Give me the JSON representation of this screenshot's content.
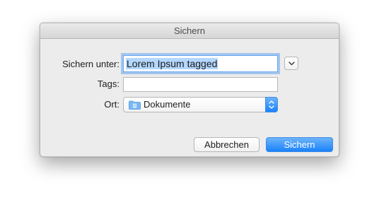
{
  "dialog": {
    "title": "Sichern"
  },
  "form": {
    "save_as_label": "Sichern unter:",
    "save_as_value": "Lorem Ipsum tagged",
    "tags_label": "Tags:",
    "tags_value": "",
    "location_label": "Ort:",
    "location_value": "Dokumente"
  },
  "buttons": {
    "cancel_label": "Abbrechen",
    "save_label": "Sichern"
  },
  "icons": {
    "expand": "chevron-down-icon",
    "folder": "folder-icon",
    "stepper": "up-down-stepper-icon"
  },
  "colors": {
    "accent": "#1a82fb",
    "selection": "#b3d7ff",
    "window_bg": "#ececec"
  }
}
